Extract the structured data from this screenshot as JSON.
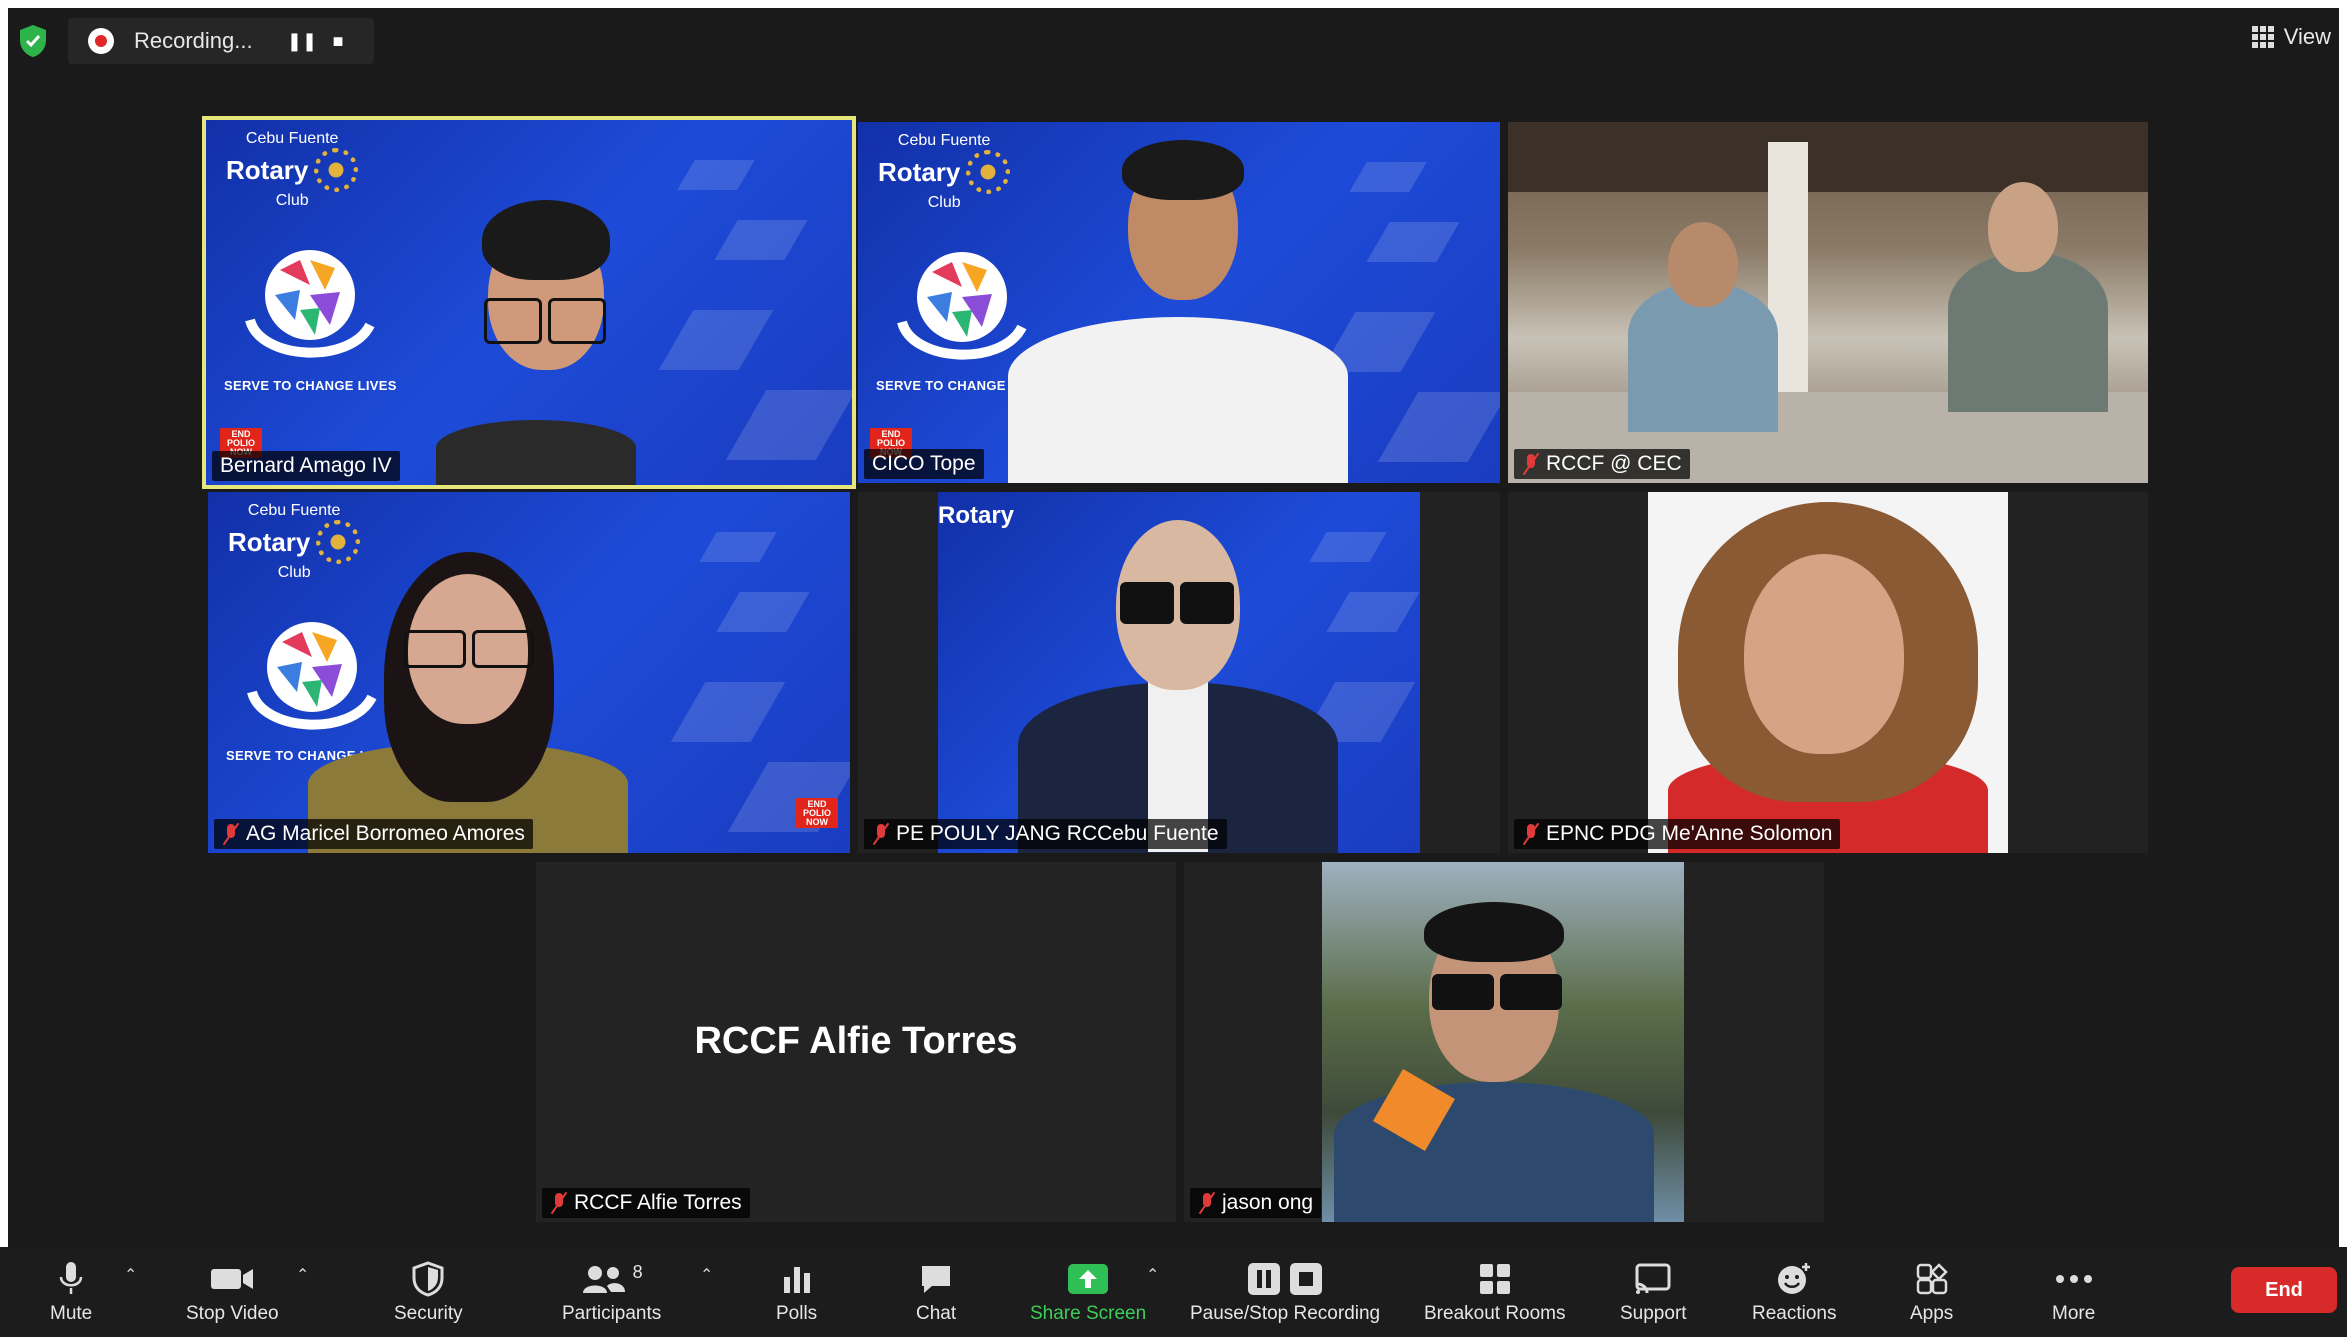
{
  "topbar": {
    "recording_label": "Recording...",
    "view_label": "View"
  },
  "participants": [
    {
      "name": "Bernard Amago IV",
      "muted": false,
      "active_speaker": true
    },
    {
      "name": "CICO Tope",
      "muted": false
    },
    {
      "name": "RCCF @ CEC",
      "muted": true
    },
    {
      "name": "AG Maricel Borromeo Amores",
      "muted": true
    },
    {
      "name": "PE POULY JANG RCCebu Fuente",
      "muted": true
    },
    {
      "name": "EPNC PDG Me'Anne Solomon",
      "muted": true
    },
    {
      "name": "RCCF Alfie Torres",
      "muted": true,
      "video_off": true
    },
    {
      "name": "jason ong",
      "muted": true
    }
  ],
  "background": {
    "club_line1": "Cebu Fuente",
    "club_line2": "Rotary",
    "club_line3": "Club",
    "tagline": "SERVE TO CHANGE LIVES",
    "badge": "END POLIO NOW"
  },
  "toolbar": {
    "mute": "Mute",
    "stop_video": "Stop Video",
    "security": "Security",
    "participants": "Participants",
    "participants_count": "8",
    "polls": "Polls",
    "chat": "Chat",
    "share_screen": "Share Screen",
    "pause_stop_recording": "Pause/Stop Recording",
    "breakout_rooms": "Breakout Rooms",
    "support": "Support",
    "reactions": "Reactions",
    "apps": "Apps",
    "more": "More",
    "end": "End"
  },
  "colors": {
    "active_speaker_border": "#e6e67a",
    "end_button": "#d92a2a",
    "share_screen": "#3ccf5a",
    "rotary_blue": "#1d4bd8"
  }
}
